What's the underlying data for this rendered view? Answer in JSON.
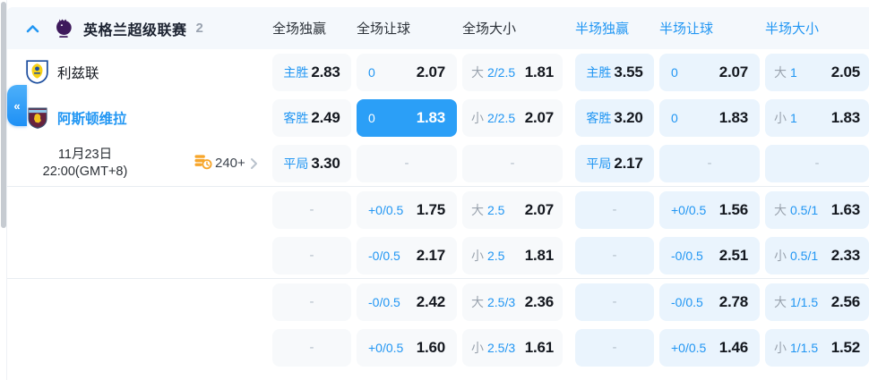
{
  "header": {
    "league": "英格兰超级联赛",
    "match_count": "2",
    "columns": {
      "full": [
        "全场独赢",
        "全场让球",
        "全场大小"
      ],
      "half": [
        "半场独赢",
        "半场让球",
        "半场大小"
      ]
    }
  },
  "match": {
    "home": "利兹联",
    "away": "阿斯顿维拉",
    "date": "11月23日",
    "time": "22:00(GMT+8)",
    "markets_count": "240+"
  },
  "ui": {
    "collapse_glyph": "«",
    "icons": {
      "group_toggle": "chevron-up-icon",
      "league_logo": "premier-league-lion-icon",
      "home_crest": "leeds-united-crest-icon",
      "away_crest": "aston-villa-crest-icon",
      "markets": "coins-clock-icon",
      "markets_more": "chevron-right-icon",
      "sidebar": "double-chevron-left-icon"
    }
  },
  "colors": {
    "accent_blue": "#2196f3",
    "selected_cell_bg": "#2b9ff7",
    "full_cell_bg": "#f7f9fb",
    "half_cell_bg": "#eaf4fd",
    "header_bg": "#f4f8fc",
    "gray_label": "#9aa3ae",
    "dark_text": "#14181f",
    "orange_icon": "#f7a62b"
  },
  "odds": {
    "empty_placeholder": "-",
    "sections": [
      {
        "rows": [
          {
            "cells": [
              {
                "type": "win",
                "label": "主胜",
                "odds": "2.83",
                "zone": "full"
              },
              {
                "type": "line",
                "line": "0",
                "odds": "2.07",
                "zone": "full"
              },
              {
                "type": "ou",
                "side": "大",
                "line": "2/2.5",
                "odds": "1.81",
                "zone": "full"
              },
              {
                "type": "win",
                "label": "主胜",
                "odds": "3.55",
                "zone": "half"
              },
              {
                "type": "line",
                "line": "0",
                "odds": "2.07",
                "zone": "half"
              },
              {
                "type": "ou",
                "side": "大",
                "line": "1",
                "odds": "2.05",
                "zone": "half"
              }
            ]
          },
          {
            "cells": [
              {
                "type": "win",
                "label": "客胜",
                "odds": "2.49",
                "zone": "full"
              },
              {
                "type": "line",
                "line": "0",
                "odds": "1.83",
                "zone": "full",
                "selected": true
              },
              {
                "type": "ou",
                "side": "小",
                "line": "2/2.5",
                "odds": "2.07",
                "zone": "full"
              },
              {
                "type": "win",
                "label": "客胜",
                "odds": "3.20",
                "zone": "half"
              },
              {
                "type": "line",
                "line": "0",
                "odds": "1.83",
                "zone": "half"
              },
              {
                "type": "ou",
                "side": "小",
                "line": "1",
                "odds": "1.83",
                "zone": "half"
              }
            ]
          },
          {
            "cells": [
              {
                "type": "win",
                "label": "平局",
                "odds": "3.30",
                "zone": "full"
              },
              {
                "type": "empty",
                "zone": "full"
              },
              {
                "type": "empty",
                "zone": "full"
              },
              {
                "type": "win",
                "label": "平局",
                "odds": "2.17",
                "zone": "half"
              },
              {
                "type": "empty",
                "zone": "half"
              },
              {
                "type": "empty",
                "zone": "half"
              }
            ]
          }
        ]
      },
      {
        "rows": [
          {
            "cells": [
              {
                "type": "empty",
                "zone": "full"
              },
              {
                "type": "line",
                "line": "+0/0.5",
                "odds": "1.75",
                "zone": "full"
              },
              {
                "type": "ou",
                "side": "大",
                "line": "2.5",
                "odds": "2.07",
                "zone": "full"
              },
              {
                "type": "empty",
                "zone": "half"
              },
              {
                "type": "line",
                "line": "+0/0.5",
                "odds": "1.56",
                "zone": "half"
              },
              {
                "type": "ou",
                "side": "大",
                "line": "0.5/1",
                "odds": "1.63",
                "zone": "half"
              }
            ]
          },
          {
            "cells": [
              {
                "type": "empty",
                "zone": "full"
              },
              {
                "type": "line",
                "line": "-0/0.5",
                "odds": "2.17",
                "zone": "full"
              },
              {
                "type": "ou",
                "side": "小",
                "line": "2.5",
                "odds": "1.81",
                "zone": "full"
              },
              {
                "type": "empty",
                "zone": "half"
              },
              {
                "type": "line",
                "line": "-0/0.5",
                "odds": "2.51",
                "zone": "half"
              },
              {
                "type": "ou",
                "side": "小",
                "line": "0.5/1",
                "odds": "2.33",
                "zone": "half"
              }
            ]
          }
        ]
      },
      {
        "rows": [
          {
            "cells": [
              {
                "type": "empty",
                "zone": "full"
              },
              {
                "type": "line",
                "line": "-0/0.5",
                "odds": "2.42",
                "zone": "full"
              },
              {
                "type": "ou",
                "side": "大",
                "line": "2.5/3",
                "odds": "2.36",
                "zone": "full"
              },
              {
                "type": "empty",
                "zone": "half"
              },
              {
                "type": "line",
                "line": "-0/0.5",
                "odds": "2.78",
                "zone": "half"
              },
              {
                "type": "ou",
                "side": "大",
                "line": "1/1.5",
                "odds": "2.56",
                "zone": "half"
              }
            ]
          },
          {
            "cells": [
              {
                "type": "empty",
                "zone": "full"
              },
              {
                "type": "line",
                "line": "+0/0.5",
                "odds": "1.60",
                "zone": "full"
              },
              {
                "type": "ou",
                "side": "小",
                "line": "2.5/3",
                "odds": "1.61",
                "zone": "full"
              },
              {
                "type": "empty",
                "zone": "half"
              },
              {
                "type": "line",
                "line": "+0/0.5",
                "odds": "1.46",
                "zone": "half"
              },
              {
                "type": "ou",
                "side": "小",
                "line": "1/1.5",
                "odds": "1.52",
                "zone": "half"
              }
            ]
          }
        ]
      }
    ]
  }
}
